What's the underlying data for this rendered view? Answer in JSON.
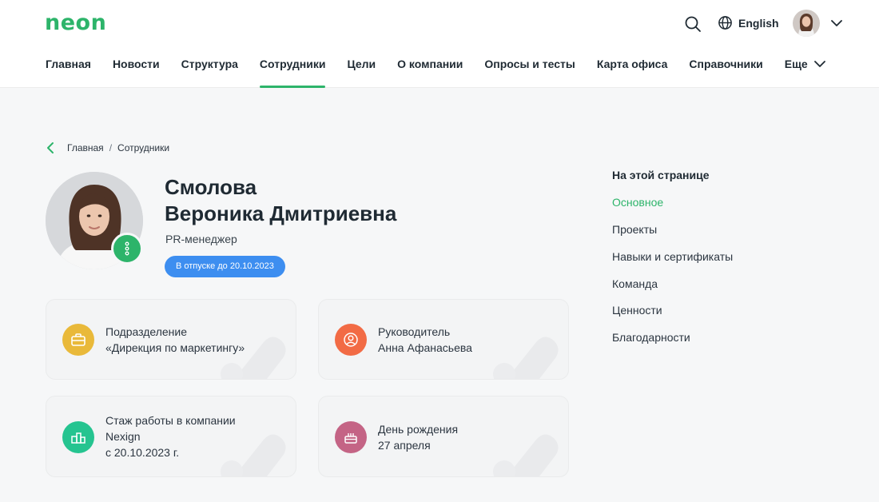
{
  "header": {
    "logo": "neon",
    "language": "English",
    "nav": [
      {
        "label": "Главная"
      },
      {
        "label": "Новости"
      },
      {
        "label": "Структура"
      },
      {
        "label": "Сотрудники",
        "active": true
      },
      {
        "label": "Цели"
      },
      {
        "label": "О компании"
      },
      {
        "label": "Опросы и тесты"
      },
      {
        "label": "Карта офиса"
      },
      {
        "label": "Справочники"
      }
    ],
    "more_label": "Еще"
  },
  "breadcrumb": {
    "items": [
      "Главная",
      "Сотрудники"
    ],
    "separator": "/"
  },
  "profile": {
    "surname": "Смолова",
    "given_names": "Вероника Дмитриевна",
    "role": "PR-менеджер",
    "status": "В отпуске до 20.10.2023"
  },
  "cards": {
    "department": {
      "label": "Подразделение",
      "value": "«Дирекция по маркетингу»",
      "icon": "briefcase-icon",
      "color": "#e9b93a"
    },
    "manager": {
      "label": "Руководитель",
      "value": "Анна Афанасьева",
      "icon": "person-icon",
      "color": "#f26b45"
    },
    "tenure": {
      "label": "Стаж работы в компании",
      "value1": "Nexign",
      "value2": "с 20.10.2023 г.",
      "icon": "building-icon",
      "color": "#25c490"
    },
    "birthday": {
      "label": "День рождения",
      "value": "27 апреля",
      "icon": "cake-icon",
      "color": "#c46485"
    }
  },
  "toc": {
    "title": "На этой странице",
    "items": [
      "Основное",
      "Проекты",
      "Навыки и сертификаты",
      "Команда",
      "Ценности",
      "Благодарности"
    ]
  },
  "colors": {
    "accent": "#2db46a",
    "badge": "#3d8ef0"
  }
}
